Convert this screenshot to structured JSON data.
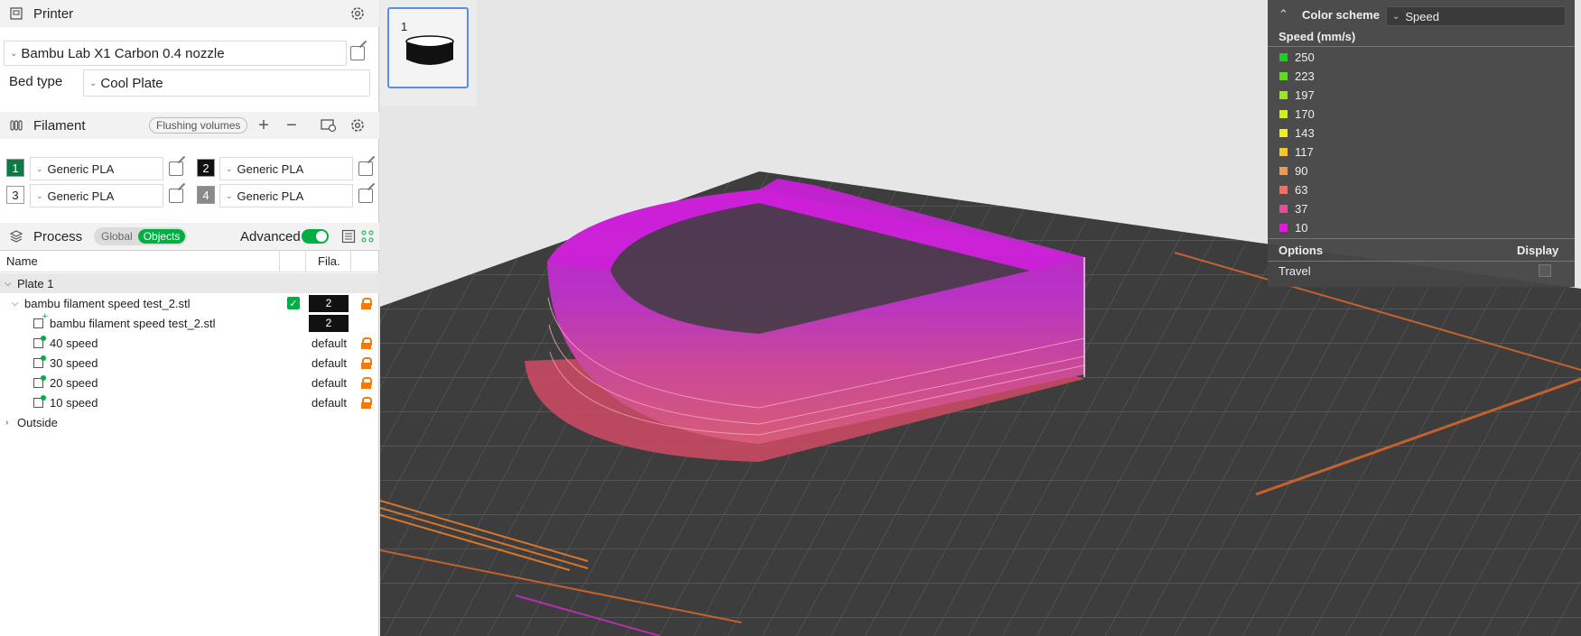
{
  "printer": {
    "title": "Printer",
    "selected": "Bambu Lab X1 Carbon 0.4 nozzle",
    "bed_type_label": "Bed type",
    "bed_type_value": "Cool Plate"
  },
  "filament": {
    "title": "Filament",
    "flushing_label": "Flushing volumes",
    "slots": [
      {
        "num": "1",
        "name": "Generic PLA",
        "color": "#0d7a45"
      },
      {
        "num": "2",
        "name": "Generic PLA",
        "color": "#111111"
      },
      {
        "num": "3",
        "name": "Generic PLA",
        "color": "#ffffff"
      },
      {
        "num": "4",
        "name": "Generic PLA",
        "color": "#8a8a8a"
      }
    ]
  },
  "process": {
    "title": "Process",
    "tab_global": "Global",
    "tab_objects": "Objects",
    "advanced_label": "Advanced"
  },
  "tree": {
    "col_name": "Name",
    "col_fila": "Fila.",
    "plate": "Plate 1",
    "object_name": "bambu filament speed test_2.stl",
    "object_fila": "2",
    "part_name": "bambu filament speed test_2.stl",
    "part_fila": "2",
    "modifiers": [
      {
        "name": "40 speed",
        "fila": "default"
      },
      {
        "name": "30 speed",
        "fila": "default"
      },
      {
        "name": "20 speed",
        "fila": "default"
      },
      {
        "name": "10 speed",
        "fila": "default"
      }
    ],
    "outside": "Outside"
  },
  "thumbnail": {
    "index": "1"
  },
  "legend": {
    "color_scheme_label": "Color scheme",
    "color_scheme_value": "Speed",
    "unit_label": "Speed (mm/s)",
    "entries": [
      {
        "value": "250",
        "color": "#17d11a"
      },
      {
        "value": "223",
        "color": "#5dde18"
      },
      {
        "value": "197",
        "color": "#9be815"
      },
      {
        "value": "170",
        "color": "#d4ef16"
      },
      {
        "value": "143",
        "color": "#f4ee12"
      },
      {
        "value": "117",
        "color": "#f6c628"
      },
      {
        "value": "90",
        "color": "#f09a45"
      },
      {
        "value": "63",
        "color": "#ec7164"
      },
      {
        "value": "37",
        "color": "#e949a1"
      },
      {
        "value": "10",
        "color": "#e517e2"
      }
    ],
    "options_label": "Options",
    "display_label": "Display",
    "travel_label": "Travel"
  },
  "colors": {
    "accent": "#00ae42",
    "bed": "#3b3b3b",
    "print_top": "#c026d3",
    "print_base": "#d5536f"
  }
}
